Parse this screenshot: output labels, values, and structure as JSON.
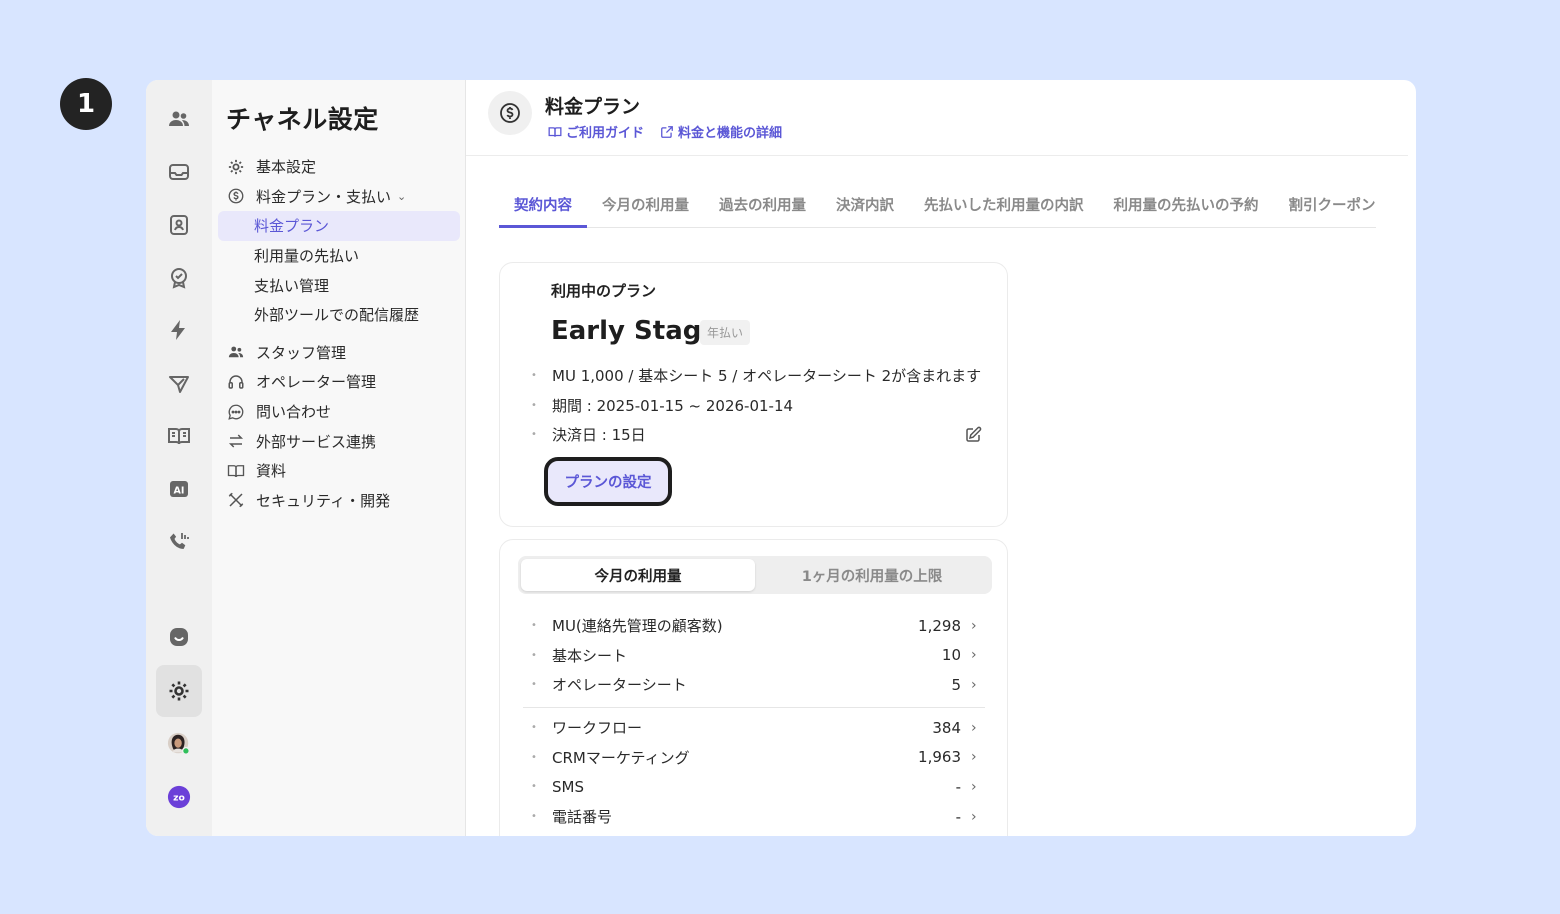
{
  "step_badge": "1",
  "sidebar": {
    "title": "チャネル設定",
    "items": [
      {
        "label": "基本設定",
        "icon": "gear-icon"
      },
      {
        "label": "料金プラン・支払い",
        "icon": "dollar-circle-icon",
        "expanded": true
      },
      {
        "label": "料金プラン",
        "sub": true,
        "active": true
      },
      {
        "label": "利用量の先払い",
        "sub": true
      },
      {
        "label": "支払い管理",
        "sub": true
      },
      {
        "label": "外部ツールでの配信履歴",
        "sub": true
      },
      {
        "label": "スタッフ管理",
        "icon": "users-icon"
      },
      {
        "label": "オペレーター管理",
        "icon": "headset-icon"
      },
      {
        "label": "問い合わせ",
        "icon": "chat-bubble-icon"
      },
      {
        "label": "外部サービス連携",
        "icon": "arrows-exchange-icon"
      },
      {
        "label": "資料",
        "icon": "book-icon"
      },
      {
        "label": "セキュリティ・開発",
        "icon": "tools-icon"
      }
    ]
  },
  "header": {
    "title": "料金プラン",
    "links": [
      "ご利用ガイド",
      "料金と機能の詳細"
    ]
  },
  "tabs": [
    "契約内容",
    "今月の利用量",
    "過去の利用量",
    "決済内訳",
    "先払いした利用量の内訳",
    "利用量の先払いの予約",
    "割引クーポン"
  ],
  "active_tab": "契約内容",
  "plan": {
    "label": "利用中のプラン",
    "name": "Early Stage",
    "billing_badge": "年払い",
    "details": [
      "MU 1,000 / 基本シート 5 / オペレーターシート 2が含まれます",
      "期間 : 2025-01-15 ~ 2026-01-14",
      "決済日 : 15日"
    ],
    "button_label": "プランの設定"
  },
  "usage": {
    "segments": [
      "今月の利用量",
      "1ヶ月の利用量の上限"
    ],
    "active_segment": "今月の利用量",
    "group1": [
      {
        "name": "MU(連絡先管理の顧客数)",
        "value": "1,298"
      },
      {
        "name": "基本シート",
        "value": "10"
      },
      {
        "name": "オペレーターシート",
        "value": "5"
      }
    ],
    "group2": [
      {
        "name": "ワークフロー",
        "value": "384"
      },
      {
        "name": "CRMマーケティング",
        "value": "1,963"
      },
      {
        "name": "SMS",
        "value": "-"
      },
      {
        "name": "電話番号",
        "value": "-"
      }
    ]
  },
  "colors": {
    "accent": "#5b57d6",
    "accent_bg": "#e9e8fb",
    "page_bg": "#d8e5ff",
    "online": "#2fbf5a",
    "brand_purple": "#6b3fd8"
  },
  "rail_icons": [
    "contacts-icon",
    "inbox-icon",
    "contact-card-icon",
    "badge-check-icon",
    "lightning-icon",
    "send-icon",
    "book-open-icon",
    "ai-icon",
    "phone-icon",
    "chat-face-icon",
    "settings-icon",
    "avatar",
    "zo-logo"
  ],
  "brand_logo_text": "zo"
}
